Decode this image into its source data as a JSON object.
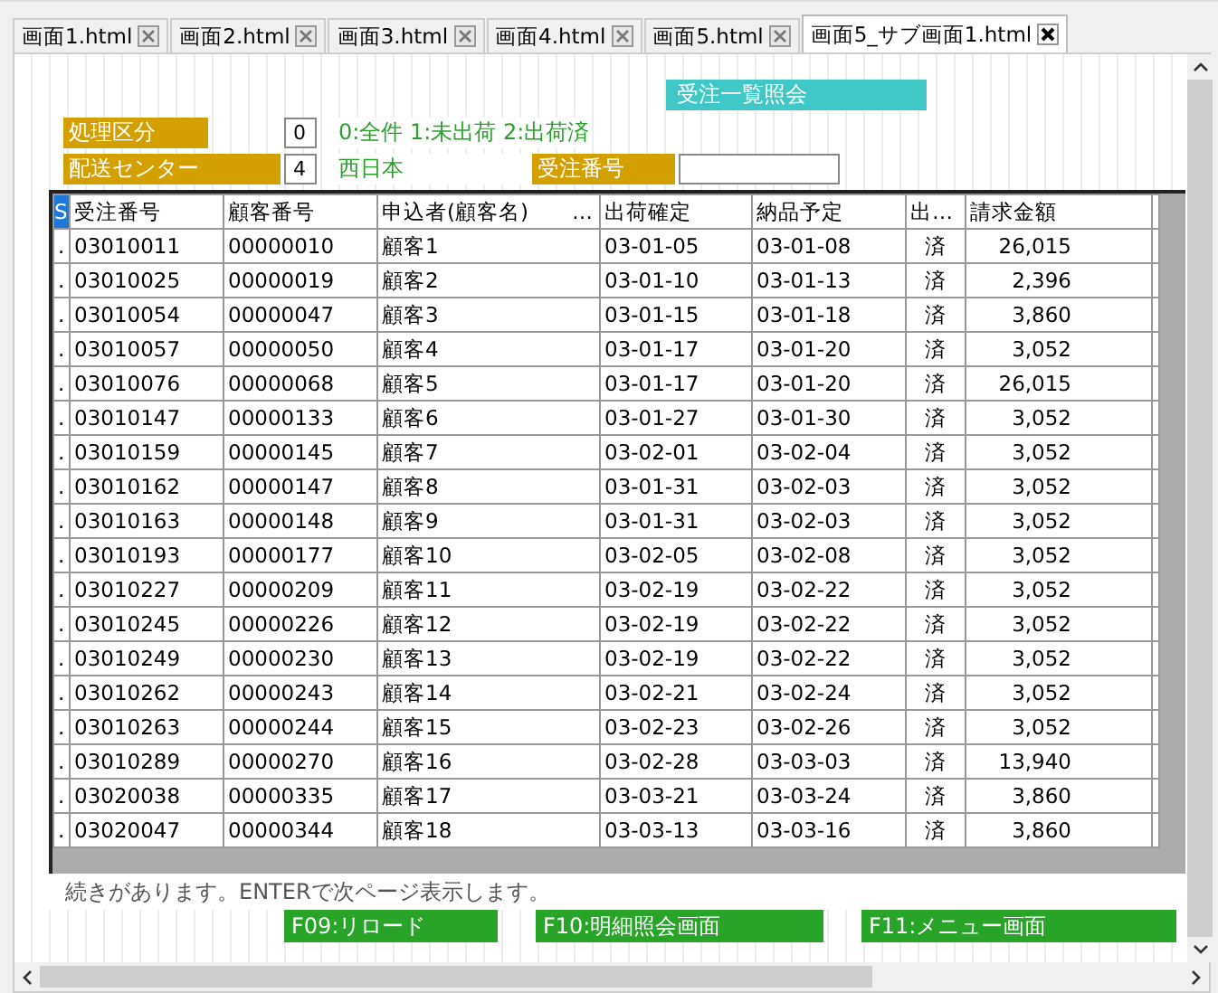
{
  "tabs": [
    {
      "label": "画面1.html",
      "selected": false
    },
    {
      "label": "画面2.html",
      "selected": false
    },
    {
      "label": "画面3.html",
      "selected": false
    },
    {
      "label": "画面4.html",
      "selected": false
    },
    {
      "label": "画面5.html",
      "selected": false
    },
    {
      "label": "画面5_サブ画面1.html",
      "selected": true
    }
  ],
  "screen_title": "受注一覧照会",
  "filters": [
    {
      "label": "処理区分",
      "value": "0",
      "note": "0:全件 1:未出荷 2:出荷済"
    },
    {
      "label": "配送センター",
      "value": "4",
      "note": "西日本"
    }
  ],
  "order_number": {
    "label": "受注番号"
  },
  "table": {
    "columns": [
      "S",
      "受注番号",
      "顧客番号",
      "申込者(顧客名)　　…",
      "出荷確定",
      "納品予定",
      "出…",
      "請求金額"
    ],
    "rows": [
      [
        ".",
        "03010011",
        "00000010",
        "顧客1",
        "03-01-05",
        "03-01-08",
        "済",
        "26,015"
      ],
      [
        ".",
        "03010025",
        "00000019",
        "顧客2",
        "03-01-10",
        "03-01-13",
        "済",
        "2,396"
      ],
      [
        ".",
        "03010054",
        "00000047",
        "顧客3",
        "03-01-15",
        "03-01-18",
        "済",
        "3,860"
      ],
      [
        ".",
        "03010057",
        "00000050",
        "顧客4",
        "03-01-17",
        "03-01-20",
        "済",
        "3,052"
      ],
      [
        ".",
        "03010076",
        "00000068",
        "顧客5",
        "03-01-17",
        "03-01-20",
        "済",
        "26,015"
      ],
      [
        ".",
        "03010147",
        "00000133",
        "顧客6",
        "03-01-27",
        "03-01-30",
        "済",
        "3,052"
      ],
      [
        ".",
        "03010159",
        "00000145",
        "顧客7",
        "03-02-01",
        "03-02-04",
        "済",
        "3,052"
      ],
      [
        ".",
        "03010162",
        "00000147",
        "顧客8",
        "03-01-31",
        "03-02-03",
        "済",
        "3,052"
      ],
      [
        ".",
        "03010163",
        "00000148",
        "顧客9",
        "03-01-31",
        "03-02-03",
        "済",
        "3,052"
      ],
      [
        ".",
        "03010193",
        "00000177",
        "顧客10",
        "03-02-05",
        "03-02-08",
        "済",
        "3,052"
      ],
      [
        ".",
        "03010227",
        "00000209",
        "顧客11",
        "03-02-19",
        "03-02-22",
        "済",
        "3,052"
      ],
      [
        ".",
        "03010245",
        "00000226",
        "顧客12",
        "03-02-19",
        "03-02-22",
        "済",
        "3,052"
      ],
      [
        ".",
        "03010249",
        "00000230",
        "顧客13",
        "03-02-19",
        "03-02-22",
        "済",
        "3,052"
      ],
      [
        ".",
        "03010262",
        "00000243",
        "顧客14",
        "03-02-21",
        "03-02-24",
        "済",
        "3,052"
      ],
      [
        ".",
        "03010263",
        "00000244",
        "顧客15",
        "03-02-23",
        "03-02-26",
        "済",
        "3,052"
      ],
      [
        ".",
        "03010289",
        "00000270",
        "顧客16",
        "03-02-28",
        "03-03-03",
        "済",
        "13,940"
      ],
      [
        ".",
        "03020038",
        "00000335",
        "顧客17",
        "03-03-21",
        "03-03-24",
        "済",
        "3,860"
      ],
      [
        ".",
        "03020047",
        "00000344",
        "顧客18",
        "03-03-13",
        "03-03-16",
        "済",
        "3,860"
      ]
    ]
  },
  "message": "続きがあります。ENTERで次ページ表示します。",
  "function_keys": [
    "F09:リロード",
    "F10:明細照会画面",
    "F11:メニュー画面"
  ]
}
